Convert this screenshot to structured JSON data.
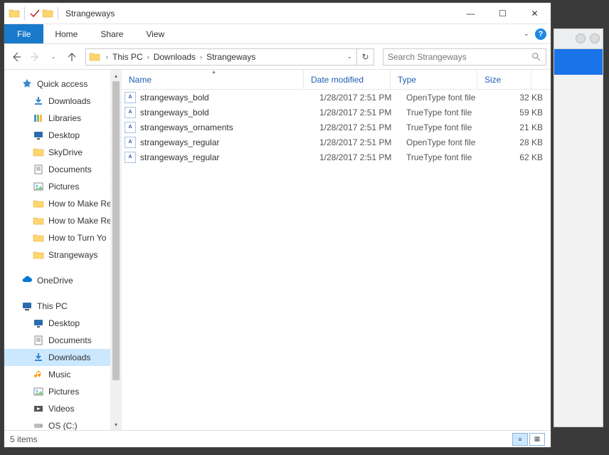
{
  "titlebar": {
    "title": "Strangeways"
  },
  "ribbon": {
    "file": "File",
    "home": "Home",
    "share": "Share",
    "view": "View"
  },
  "address": {
    "root": "This PC",
    "crumbs": [
      "Downloads",
      "Strangeways"
    ]
  },
  "search": {
    "placeholder": "Search Strangeways"
  },
  "nav_pane": {
    "quick_access": "Quick access",
    "pinned": [
      {
        "label": "Downloads",
        "icon": "download"
      },
      {
        "label": "Libraries",
        "icon": "libraries"
      },
      {
        "label": "Desktop",
        "icon": "desktop"
      },
      {
        "label": "SkyDrive",
        "icon": "skydrive"
      },
      {
        "label": "Documents",
        "icon": "documents"
      },
      {
        "label": "Pictures",
        "icon": "pictures"
      }
    ],
    "recent": [
      "How to Make Re",
      "How to Make Re",
      "How to Turn Yo",
      "Strangeways"
    ],
    "onedrive": "OneDrive",
    "this_pc": "This PC",
    "pc_items": [
      {
        "label": "Desktop",
        "icon": "desktop"
      },
      {
        "label": "Documents",
        "icon": "documents"
      },
      {
        "label": "Downloads",
        "icon": "download",
        "selected": true
      },
      {
        "label": "Music",
        "icon": "music"
      },
      {
        "label": "Pictures",
        "icon": "pictures"
      },
      {
        "label": "Videos",
        "icon": "videos"
      },
      {
        "label": "OS (C:)",
        "icon": "drive"
      }
    ]
  },
  "columns": {
    "name": "Name",
    "date": "Date modified",
    "type": "Type",
    "size": "Size"
  },
  "files": [
    {
      "name": "strangeways_bold",
      "date": "1/28/2017 2:51 PM",
      "type": "OpenType font file",
      "size": "32 KB"
    },
    {
      "name": "strangeways_bold",
      "date": "1/28/2017 2:51 PM",
      "type": "TrueType font file",
      "size": "59 KB"
    },
    {
      "name": "strangeways_ornaments",
      "date": "1/28/2017 2:51 PM",
      "type": "TrueType font file",
      "size": "21 KB"
    },
    {
      "name": "strangeways_regular",
      "date": "1/28/2017 2:51 PM",
      "type": "OpenType font file",
      "size": "28 KB"
    },
    {
      "name": "strangeways_regular",
      "date": "1/28/2017 2:51 PM",
      "type": "TrueType font file",
      "size": "62 KB"
    }
  ],
  "status": {
    "count": "5 items"
  }
}
